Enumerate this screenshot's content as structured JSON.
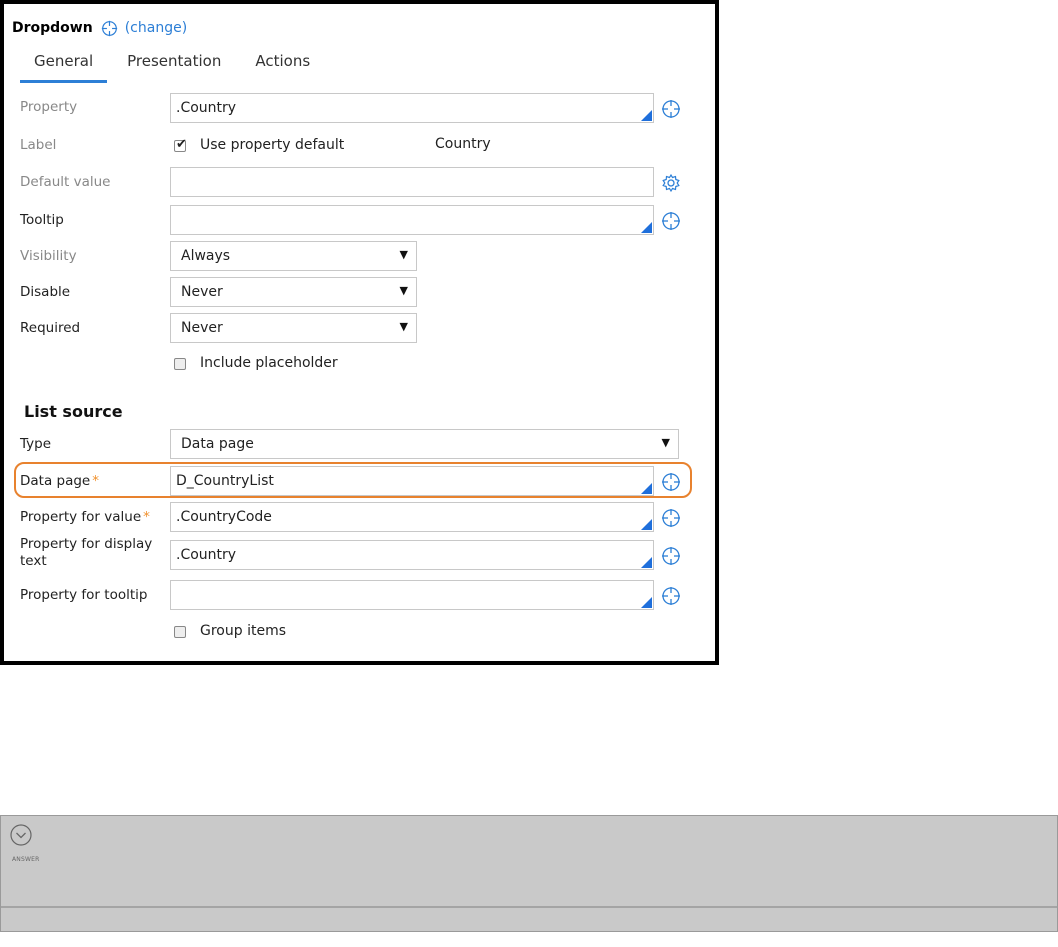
{
  "header": {
    "title": "Dropdown",
    "change_label": "(change)"
  },
  "tabs": [
    {
      "label": "General",
      "active": true
    },
    {
      "label": "Presentation",
      "active": false
    },
    {
      "label": "Actions",
      "active": false
    }
  ],
  "general": {
    "property": {
      "label": "Property",
      "value": ".Country"
    },
    "label": {
      "label": "Label",
      "checkbox_label": "Use property default",
      "checked": true,
      "default_text": "Country"
    },
    "default_value": {
      "label": "Default value",
      "value": ""
    },
    "tooltip": {
      "label": "Tooltip",
      "value": ""
    },
    "visibility": {
      "label": "Visibility",
      "value": "Always"
    },
    "disable": {
      "label": "Disable",
      "value": "Never"
    },
    "required": {
      "label": "Required",
      "value": "Never"
    },
    "include_placeholder": {
      "label": "Include placeholder",
      "checked": false
    }
  },
  "list_source": {
    "title": "List source",
    "type": {
      "label": "Type",
      "value": "Data page"
    },
    "data_page": {
      "label": "Data page",
      "value": "D_CountryList"
    },
    "value_prop": {
      "label": "Property for value",
      "value": ".CountryCode"
    },
    "display_prop": {
      "label": "Property for display text",
      "value": ".Country"
    },
    "tooltip_prop": {
      "label": "Property for tooltip",
      "value": ""
    },
    "group_items": {
      "label": "Group items",
      "checked": false
    }
  },
  "required_marker": "*",
  "answer": {
    "label": "ANSWER"
  },
  "colors": {
    "accent": "#2d7fd6",
    "highlight": "#e8822e",
    "required": "#f0902c",
    "answer_bg": "#c9c9c9"
  },
  "icons": {
    "target": "crosshair-icon",
    "settings": "gear-icon",
    "answer": "chevron-down-circle-icon"
  }
}
